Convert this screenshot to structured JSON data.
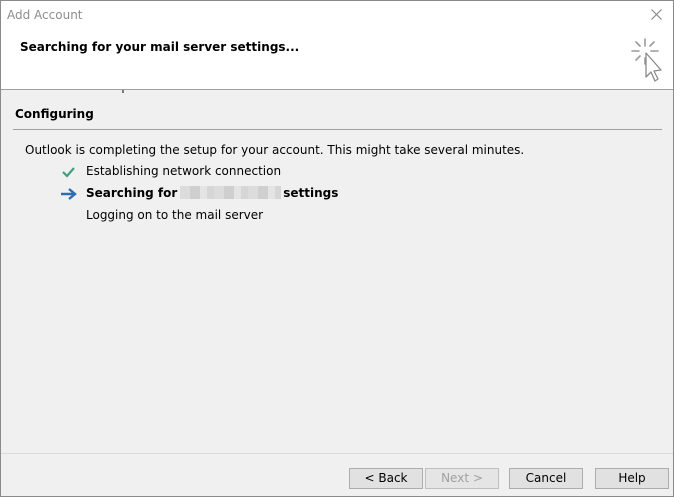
{
  "window": {
    "title": "Add Account",
    "close_icon": "close-icon"
  },
  "header": {
    "title": "Searching for your mail server settings...",
    "icon": "wizard-cursor-icon"
  },
  "section": {
    "title": "Configuring",
    "intro": "Outlook is completing the setup for your account. This might take several minutes."
  },
  "steps": [
    {
      "label": "Establishing network connection",
      "status": "done",
      "icon": "check-icon"
    },
    {
      "label_before": "Searching for",
      "label_after": "settings",
      "status": "in-progress",
      "icon": "arrow-right-icon"
    },
    {
      "label": "Logging on to the mail server",
      "status": "pending"
    }
  ],
  "buttons": {
    "back": "< Back",
    "next": "Next >",
    "cancel": "Cancel",
    "help": "Help"
  },
  "colors": {
    "check": "#3fa07a",
    "arrow": "#2e6db3"
  }
}
